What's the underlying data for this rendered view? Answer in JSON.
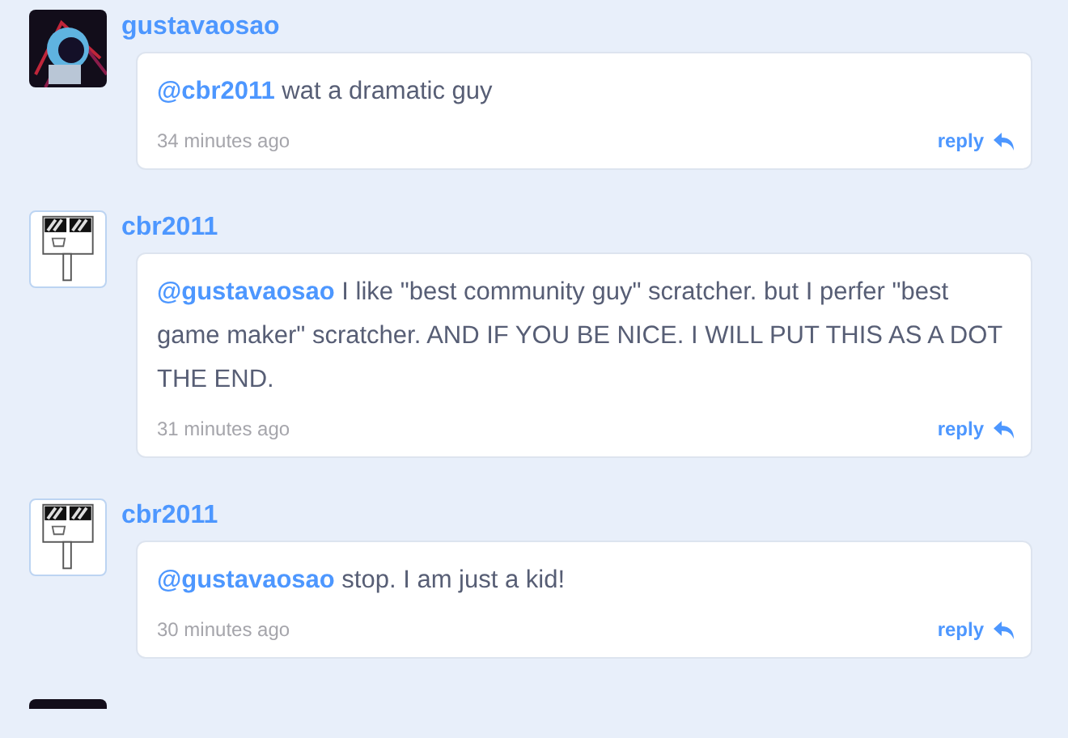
{
  "comments": [
    {
      "kind": "photo",
      "username": "gustavaosao",
      "text": "**@cbr2011** wat a dramatic guy",
      "time": "34 minutes ago",
      "reply": "reply"
    },
    {
      "kind": "sign",
      "username": "cbr2011",
      "text": "**@gustavaosao** I like \"best community guy\" scratcher. but I perfer \"best game maker\" scratcher. AND IF YOU BE NICE. I WILL PUT THIS AS A DOT THE END.",
      "time": "31 minutes ago",
      "reply": "reply"
    },
    {
      "kind": "sign",
      "username": "cbr2011",
      "text": "**@gustavaosao** stop. I am just a kid!",
      "time": "30 minutes ago",
      "reply": "reply"
    },
    {
      "kind": "photo"
    }
  ]
}
